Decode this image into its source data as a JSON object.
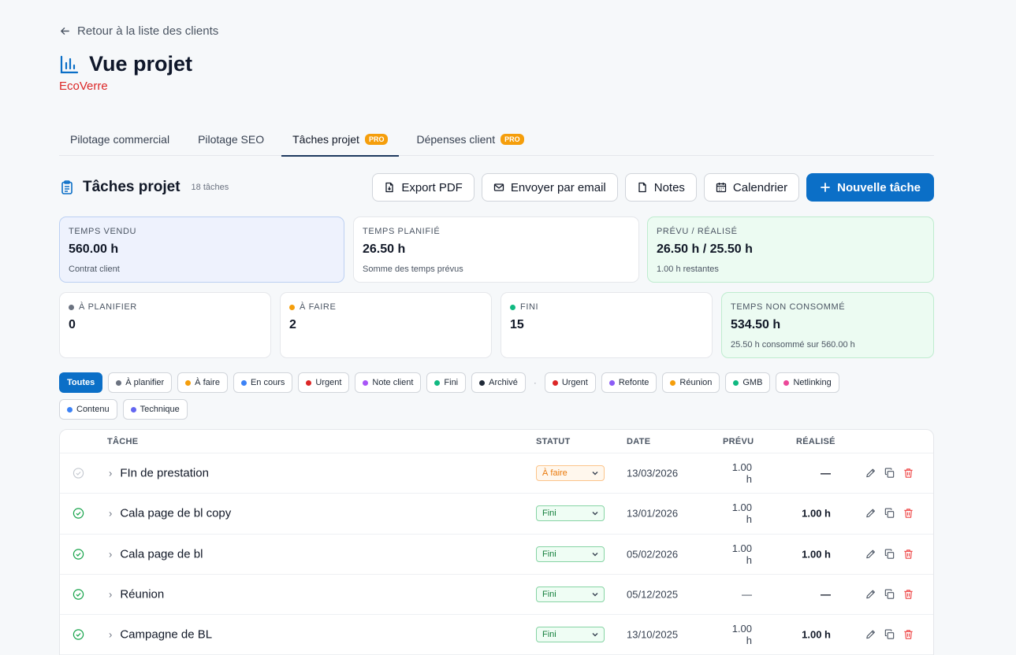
{
  "nav": {
    "back_label": "Retour à la liste des clients"
  },
  "header": {
    "title": "Vue projet",
    "client": "EcoVerre"
  },
  "tabs": [
    {
      "label": "Pilotage commercial",
      "badge": ""
    },
    {
      "label": "Pilotage SEO",
      "badge": ""
    },
    {
      "label": "Tâches projet",
      "badge": "PRO",
      "active": true
    },
    {
      "label": "Dépenses client",
      "badge": "PRO"
    }
  ],
  "section": {
    "title": "Tâches projet",
    "count": "18 tâches",
    "buttons": {
      "export": "Export PDF",
      "email": "Envoyer par email",
      "notes": "Notes",
      "calendar": "Calendrier",
      "new_task": "Nouvelle tâche"
    }
  },
  "stats": {
    "sold": {
      "label": "TEMPS VENDU",
      "value": "560.00 h",
      "sub": "Contrat client"
    },
    "planned": {
      "label": "TEMPS PLANIFIÉ",
      "value": "26.50 h",
      "sub": "Somme des temps prévus"
    },
    "forecast": {
      "label": "PRÉVU / RÉALISÉ",
      "value": "26.50 h / 25.50 h",
      "sub": "1.00 h restantes"
    },
    "to_plan": {
      "label": "À PLANIFIER",
      "value": "0"
    },
    "to_do": {
      "label": "À FAIRE",
      "value": "2"
    },
    "done": {
      "label": "FINI",
      "value": "15"
    },
    "unused": {
      "label": "TEMPS NON CONSOMMÉ",
      "value": "534.50 h",
      "sub": "25.50 h consommé sur 560.00 h"
    }
  },
  "filters": {
    "all": "Toutes",
    "statuses": [
      {
        "label": "À planifier",
        "color": "#6b7280"
      },
      {
        "label": "À faire",
        "color": "#f59e0b"
      },
      {
        "label": "En cours",
        "color": "#3b82f6"
      },
      {
        "label": "Urgent",
        "color": "#dc2626"
      },
      {
        "label": "Note client",
        "color": "#a855f7"
      },
      {
        "label": "Fini",
        "color": "#10b981"
      },
      {
        "label": "Archivé",
        "color": "#1f2937"
      }
    ],
    "separator": "·",
    "tags": [
      {
        "label": "Urgent",
        "color": "#dc2626"
      },
      {
        "label": "Refonte",
        "color": "#8b5cf6"
      },
      {
        "label": "Réunion",
        "color": "#f59e0b"
      },
      {
        "label": "GMB",
        "color": "#10b981"
      },
      {
        "label": "Netlinking",
        "color": "#ec4899"
      },
      {
        "label": "Contenu",
        "color": "#3b82f6"
      },
      {
        "label": "Technique",
        "color": "#6366f1"
      }
    ]
  },
  "table": {
    "headers": {
      "task": "TÂCHE",
      "status": "STATUT",
      "date": "DATE",
      "planned": "PRÉVU",
      "done": "RÉALISÉ"
    },
    "rows": [
      {
        "name": "FIn de prestation",
        "status": "À faire",
        "status_type": "afaire",
        "date": "13/03/2026",
        "planned": "1.00 h",
        "done": "—",
        "complete": false
      },
      {
        "name": "Cala page de bl copy",
        "status": "Fini",
        "status_type": "fini",
        "date": "13/01/2026",
        "planned": "1.00 h",
        "done": "1.00 h",
        "complete": true
      },
      {
        "name": "Cala page de bl",
        "status": "Fini",
        "status_type": "fini",
        "date": "05/02/2026",
        "planned": "1.00 h",
        "done": "1.00 h",
        "complete": true
      },
      {
        "name": "Réunion",
        "status": "Fini",
        "status_type": "fini",
        "date": "05/12/2025",
        "planned": "—",
        "done": "—",
        "complete": true
      },
      {
        "name": "Campagne de BL",
        "status": "Fini",
        "status_type": "fini",
        "date": "13/10/2025",
        "planned": "1.00 h",
        "done": "1.00 h",
        "complete": true
      }
    ]
  },
  "colors": {
    "accent": "#0b6fc7",
    "client": "#dc2626",
    "tab_underline": "#1e3a5f"
  }
}
